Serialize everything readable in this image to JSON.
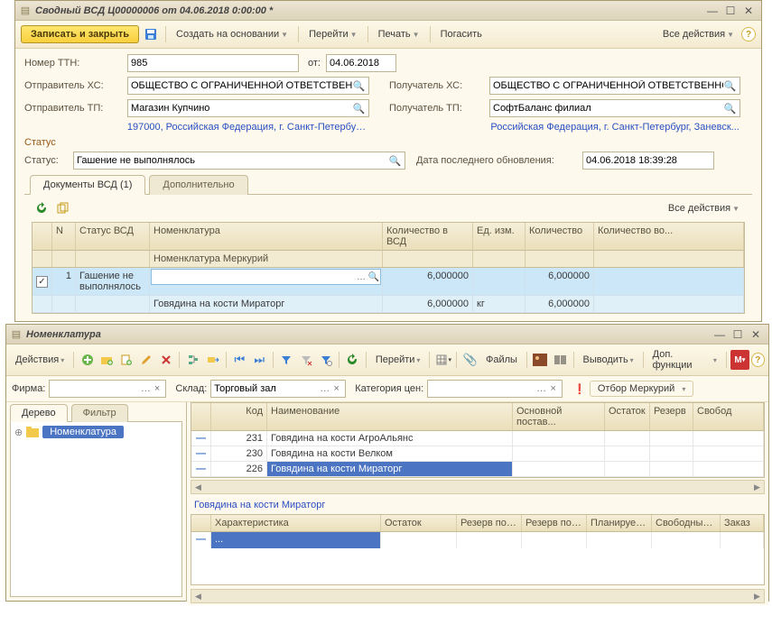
{
  "win1": {
    "title": "Сводный ВСД Ц00000006 от 04.06.2018 0:00:00 *",
    "toolbar": {
      "save_close": "Записать и закрыть",
      "create_based": "Создать на основании",
      "goto": "Перейти",
      "print": "Печать",
      "redeem": "Погасить",
      "all_actions": "Все действия"
    },
    "form": {
      "ttn_label": "Номер ТТН:",
      "ttn_value": "985",
      "from_label": "от:",
      "from_value": "04.06.2018",
      "sender_xs_label": "Отправитель ХС:",
      "sender_xs_value": "ОБЩЕСТВО С ОГРАНИЧЕННОЙ ОТВЕТСТВЕННОС",
      "receiver_xs_label": "Получатель ХС:",
      "receiver_xs_value": "ОБЩЕСТВО С ОГРАНИЧЕННОЙ ОТВЕТСТВЕННОС",
      "sender_tp_label": "Отправитель ТП:",
      "sender_tp_value": "Магазин Купчино",
      "receiver_tp_label": "Получатель ТП:",
      "receiver_tp_value": "СофтБаланс филиал",
      "sender_addr": "197000, Российская Федерация, г. Санкт-Петербург, ...",
      "receiver_addr": "Российская Федерация, г. Санкт-Петербург, Заневск...",
      "status_group": "Статус",
      "status_label": "Статус:",
      "status_value": "Гашение не выполнялось",
      "lastupd_label": "Дата последнего обновления:",
      "lastupd_value": "04.06.2018 18:39:28"
    },
    "tabs": {
      "vsd": "Документы ВСД (1)",
      "extra": "Дополнительно",
      "all_actions": "Все действия"
    },
    "grid": {
      "head": {
        "n": "N",
        "status": "Статус ВСД",
        "nomen": "Номенклатура",
        "qty_vsd": "Количество в ВСД",
        "unit": "Ед. изм.",
        "qty": "Количество",
        "qty_ret": "Количество во..."
      },
      "head2": {
        "nomen_merc": "Номенклатура Меркурий"
      },
      "row": {
        "n": "1",
        "status": "Гашение не выполнялось",
        "nomen": "",
        "qty_vsd": "6,000000",
        "unit": "",
        "qty": "6,000000",
        "qty_ret": ""
      },
      "row2": {
        "nomen_merc": "Говядина на кости Мираторг",
        "qty_vsd": "6,000000",
        "unit": "кг",
        "qty": "6,000000"
      }
    }
  },
  "win2": {
    "title": "Номенклатура",
    "toolbar": {
      "actions": "Действия",
      "goto": "Перейти",
      "files": "Файлы",
      "output": "Выводить",
      "extra_funcs": "Доп. функции"
    },
    "filter": {
      "firm_label": "Фирма:",
      "firm_value": "",
      "sklad_label": "Склад:",
      "sklad_value": "Торговый зал",
      "price_cat_label": "Категория цен:",
      "price_cat_value": "",
      "merc_sel": "Отбор Меркурий"
    },
    "left": {
      "tab_tree": "Дерево",
      "tab_filter": "Фильтр",
      "root": "Номенклатура"
    },
    "grid": {
      "head": {
        "code": "Код",
        "name": "Наименование",
        "supplier": "Основной постав...",
        "stock": "Остаток",
        "reserve": "Резерв",
        "free": "Свобод"
      },
      "rows": [
        {
          "code": "231",
          "name": "Говядина на кости АгроАльянс"
        },
        {
          "code": "230",
          "name": "Говядина на кости Велком"
        },
        {
          "code": "226",
          "name": "Говядина на кости Мираторг"
        }
      ]
    },
    "selection_name": "Говядина на кости Мираторг",
    "grid3": {
      "head": {
        "char": "Характеристика",
        "stock": "Остаток",
        "res1": "Резерв по ...",
        "res2": "Резерв по ...",
        "plan": "Планируем...",
        "free": "Свободный...",
        "order": "Заказ"
      },
      "row": {
        "char": "..."
      }
    }
  }
}
